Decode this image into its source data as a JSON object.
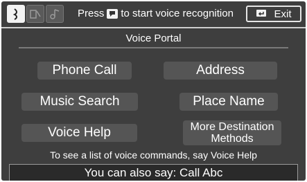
{
  "header": {
    "prompt_before": "Press",
    "prompt_after": "to start voice recognition",
    "exit_label": "Exit",
    "mode_icons": [
      "talk-mode-icon",
      "phone-mode-icon",
      "audio-mode-icon"
    ]
  },
  "title": "Voice Portal",
  "commands": [
    {
      "label": "Phone Call"
    },
    {
      "label": "Address"
    },
    {
      "label": "Music Search"
    },
    {
      "label": "Place Name"
    },
    {
      "label": "Voice Help"
    },
    {
      "label": "More Destination Methods"
    }
  ],
  "hint": "To see a list of voice commands, say Voice Help",
  "also_say": "You can also say: Call Abc",
  "colors": {
    "background": "#3e3e3e",
    "button": "#555555",
    "text": "#ffffff"
  }
}
